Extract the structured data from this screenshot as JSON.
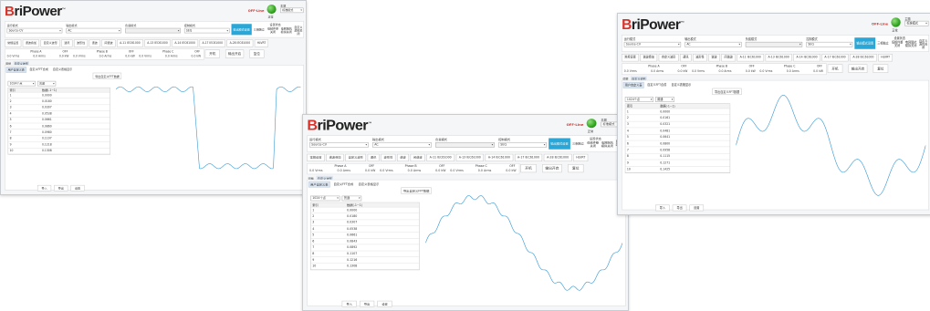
{
  "app": {
    "logo_main": "BriPower",
    "logo_tm": "™",
    "offline": "OFF-Line",
    "status_label": "正常",
    "theme_label": "主题",
    "theme_value": "标准模式"
  },
  "modes": {
    "run_label": "运行模式",
    "run_value": "Source-CV",
    "output_label": "输出模式",
    "output_value": "AC",
    "load_label": "负载模式",
    "load_value": "",
    "ctrl_label": "控制模式",
    "ctrl_value": "SEQ",
    "current_setting": "设置状态",
    "btn_output_mode": "输出模式设置",
    "btn_three_phase": "三相独立",
    "btn_voltage_ref": "低频件整关闭",
    "btn_bandwidth": "电网阻抗模拟关闭",
    "btn_custom": "自定义源控关闭"
  },
  "toolbar": [
    "常规设置",
    "谐波叠加",
    "自定义波形",
    "通讯",
    "波形性",
    "谐波",
    "间谐波",
    "A-11 IEC61000",
    "A-13 IEC61000",
    "A-14 IEC61000",
    "A-17 IEC61000",
    "A-28 IEC61000",
    "HLVRT"
  ],
  "phases": [
    {
      "name": "Phase A",
      "state": "OFF",
      "vals": [
        "0.0 Vrms",
        "0.0 Arms",
        "0.0 kW"
      ]
    },
    {
      "name": "Phase B",
      "state": "OFF",
      "vals": [
        "0.0 Vrms",
        "0.0 Arms",
        "0.0 kW"
      ]
    },
    {
      "name": "Phase C",
      "state": "OFF",
      "vals": [
        "0.0 Vrms",
        "0.0 Arms",
        "0.0 kW"
      ]
    }
  ],
  "buttons": {
    "start": "开机",
    "output": "输出开启",
    "reset": "复位"
  },
  "tabs1": [
    "调整",
    "自定义波形"
  ],
  "tabs2": [
    "用户自定义表",
    "自定义FFT合成",
    "自定义表格显示"
  ],
  "import_btn": "导出自定义FFT数据",
  "points_value": "1024个点",
  "phase_sel_value": "普通",
  "table": {
    "col1": "索引",
    "col2": "数据(-1~1)",
    "rows_w1": [
      [
        "1",
        "0.0000"
      ],
      [
        "2",
        "0.0180"
      ],
      [
        "3",
        "0.0307"
      ],
      [
        "4",
        "0.0538"
      ],
      [
        "5",
        "0.0661"
      ],
      [
        "6",
        "0.0860"
      ],
      [
        "7",
        "0.0980"
      ],
      [
        "8",
        "0.1107"
      ],
      [
        "9",
        "0.1218"
      ],
      [
        "10",
        "0.1308"
      ]
    ],
    "rows_w2": [
      [
        "1",
        "0.0000"
      ],
      [
        "2",
        "0.0180"
      ],
      [
        "3",
        "0.0307"
      ],
      [
        "4",
        "0.0538"
      ],
      [
        "5",
        "0.0661"
      ],
      [
        "6",
        "0.0843"
      ],
      [
        "7",
        "0.0892"
      ],
      [
        "8",
        "0.1107"
      ],
      [
        "9",
        "0.1216"
      ],
      [
        "10",
        "0.1308"
      ]
    ],
    "rows_w3": [
      [
        "1",
        "0.0000"
      ],
      [
        "2",
        "0.0161"
      ],
      [
        "3",
        "0.0321"
      ],
      [
        "4",
        "0.0481"
      ],
      [
        "5",
        "0.0641"
      ],
      [
        "6",
        "0.0800"
      ],
      [
        "7",
        "0.0958"
      ],
      [
        "8",
        "0.1115"
      ],
      [
        "9",
        "0.1271"
      ],
      [
        "10",
        "0.1425"
      ]
    ]
  },
  "table_buttons": [
    "导入",
    "导出",
    "设置"
  ]
}
